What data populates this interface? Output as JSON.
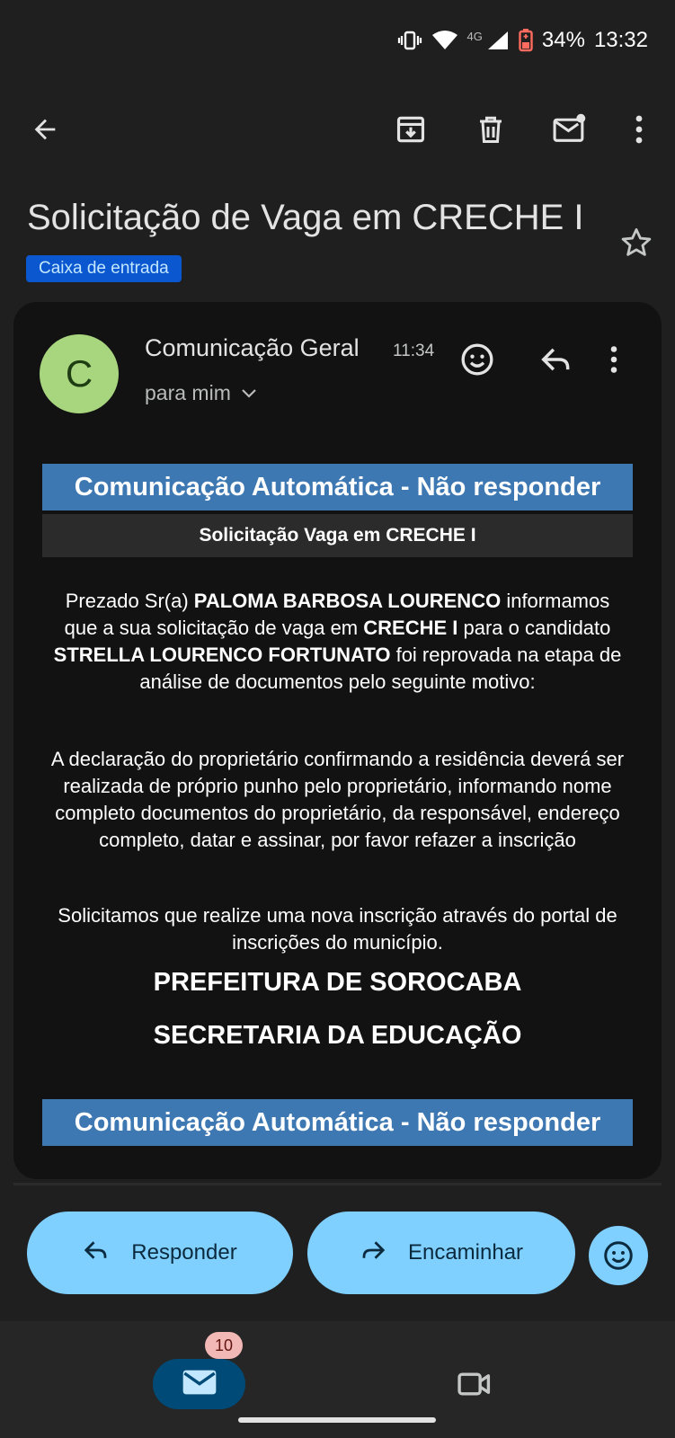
{
  "status_bar": {
    "network": "4G",
    "battery": "34%",
    "time": "13:32"
  },
  "toolbar": {
    "icons": [
      "back-arrow-icon",
      "archive-icon",
      "delete-icon",
      "mark-unread-icon",
      "more-vert-icon"
    ]
  },
  "email": {
    "subject": "Solicitação de Vaga em CRECHE I",
    "label": "Caixa de entrada",
    "sender": {
      "initial": "C",
      "name": "Comunicação Geral",
      "time": "11:34",
      "recipient": "para mim"
    },
    "body": {
      "banner_top": "Comunicação Automática - Não responder",
      "subheader": "Solicitação Vaga em CRECHE I",
      "p1": {
        "t1": "Prezado Sr(a) ",
        "guardian": "PALOMA BARBOSA LOURENCO",
        "t2": " informamos que a sua solicitação de vaga em ",
        "unit": "CRECHE I",
        "t3": " para o candidato ",
        "candidate": "STRELLA LOURENCO FORTUNATO",
        "t4": " foi reprovada na etapa de análise de documentos pelo seguinte motivo:"
      },
      "p2": "A declaração do proprietário confirmando a residência deverá ser realizada de próprio punho pelo proprietário, informando nome completo documentos do proprietário, da responsável, endereço completo, datar e assinar, por favor refazer a inscrição",
      "p3": "Solicitamos que realize uma nova inscrição através do portal de inscrições do município.",
      "footer_line1": "PREFEITURA DE SOROCABA",
      "footer_line2": "SECRETARIA DA EDUCAÇÃO",
      "banner_bottom": "Comunicação Automática - Não responder"
    }
  },
  "actions": {
    "reply": "Responder",
    "forward": "Encaminhar"
  },
  "bottom_nav": {
    "mail_badge": "10"
  },
  "colors": {
    "background": "#1f1f1f",
    "card": "#121212",
    "banner": "#3d78b3",
    "accent_pill": "#7fcfff",
    "label_chip": "#0b57d0",
    "avatar": "#a8d67f"
  }
}
